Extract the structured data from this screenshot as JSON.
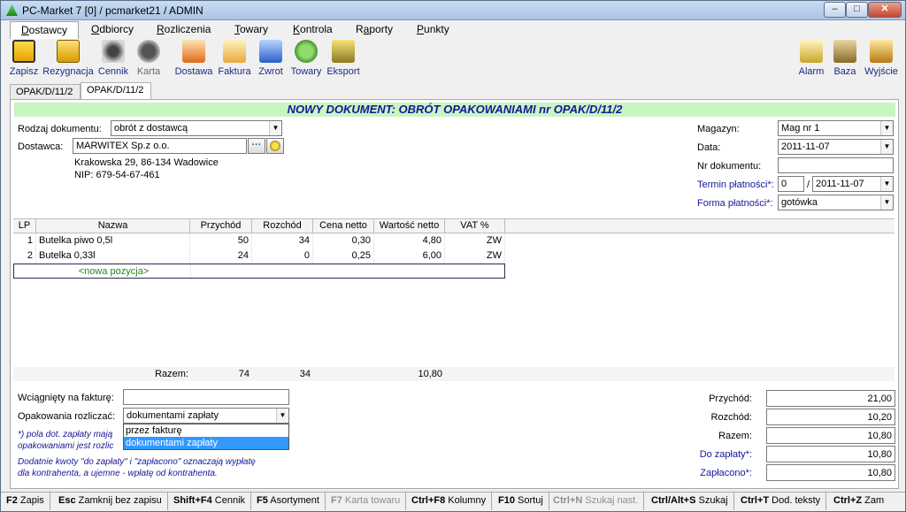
{
  "window": {
    "title": "PC-Market 7 [0] / pcmarket21 / ADMIN",
    "min": "–",
    "max": "□",
    "close": "✕"
  },
  "menu": [
    {
      "label": "Dostawcy",
      "u": "D",
      "rest": "ostawcy"
    },
    {
      "label": "Odbiorcy",
      "u": "O",
      "rest": "dbiorcy"
    },
    {
      "label": "Rozliczenia",
      "u": "R",
      "rest": "ozliczenia"
    },
    {
      "label": "Towary",
      "u": "T",
      "rest": "owary"
    },
    {
      "label": "Kontrola",
      "u": "K",
      "rest": "ontrola"
    },
    {
      "label": "Raporty",
      "pre": "R",
      "u": "a",
      "rest": "porty"
    },
    {
      "label": "Punkty",
      "u": "P",
      "rest": "unkty"
    }
  ],
  "toolbar": {
    "zapisz": "Zapisz",
    "rezygnacja": "Rezygnacja",
    "cennik": "Cennik",
    "karta": "Karta",
    "dostawa": "Dostawa",
    "faktura": "Faktura",
    "zwrot": "Zwrot",
    "towary": "Towary",
    "eksport": "Eksport",
    "alarm": "Alarm",
    "baza": "Baza",
    "wyjscie": "Wyjście"
  },
  "doc_tabs": [
    "OPAK/D/11/2",
    "OPAK/D/11/2"
  ],
  "doc": {
    "heading": "NOWY DOKUMENT: OBRÓT OPAKOWANIAMI nr OPAK/D/11/2",
    "rodzaj_label": "Rodzaj dokumentu:",
    "rodzaj_value": "obrót z dostawcą",
    "dostawca_label": "Dostawca:",
    "dostawca_value": "MARWITEX Sp.z o.o.",
    "dostawca_more": "···",
    "address": "Krakowska 29, 86-134 Wadowice",
    "nip": "NIP: 679-54-67-461",
    "magazyn_label": "Magazyn:",
    "magazyn_value": "Mag nr 1",
    "data_label": "Data:",
    "data_value": "2011-11-07",
    "nr_label": "Nr dokumentu:",
    "nr_value": "",
    "termin_label": "Termin płatności*:",
    "termin_days": "0",
    "termin_sep": "/",
    "termin_date": "2011-11-07",
    "forma_label": "Forma płatności*:",
    "forma_value": "gotówka"
  },
  "grid": {
    "headers": [
      "LP",
      "Nazwa",
      "Przychód",
      "Rozchód",
      "Cena netto",
      "Wartość netto",
      "VAT %"
    ],
    "rows": [
      {
        "lp": "1",
        "nazwa": "Butelka piwo 0,5l",
        "przychod": "50",
        "rozchod": "34",
        "cena": "0,30",
        "wartosc": "4,80",
        "vat": "ZW"
      },
      {
        "lp": "2",
        "nazwa": "Butelka 0,33l",
        "przychod": "24",
        "rozchod": "0",
        "cena": "0,25",
        "wartosc": "6,00",
        "vat": "ZW"
      }
    ],
    "new_row": "<nowa pozycja>",
    "totals": {
      "label": "Razem:",
      "przychod": "74",
      "rozchod": "34",
      "wartosc": "10,80"
    }
  },
  "bottom": {
    "faktura_label": "Wciągnięty na fakturę:",
    "faktura_value": "",
    "rozliczac_label": "Opakowania rozliczać:",
    "rozliczac_value": "dokumentami zapłaty",
    "options": [
      "przez fakturę",
      "dokumentami zapłaty"
    ],
    "note1a": "*) pola dot. zapłaty mają",
    "note1b": "opakowaniami jest rozlic",
    "note2a": "Dodatnie kwoty \"do zapłaty\" i \"zapłacono\" oznaczają wypłatę",
    "note2b": "dla kontrahenta, a ujemne - wpłatę od kontrahenta."
  },
  "summary": [
    {
      "label": "Przychód:",
      "value": "21,00",
      "blue": false
    },
    {
      "label": "Rozchód:",
      "value": "10,20",
      "blue": false
    },
    {
      "label": "Razem:",
      "value": "10,80",
      "blue": false
    },
    {
      "label": "Do zapłaty*:",
      "value": "10,80",
      "blue": true
    },
    {
      "label": "Zapłacono*:",
      "value": "10,80",
      "blue": true
    }
  ],
  "status": [
    {
      "key": "F2",
      "label": "Zapis"
    },
    {
      "key": "Esc",
      "label": "Zamknij bez zapisu"
    },
    {
      "key": "Shift+F4",
      "label": "Cennik"
    },
    {
      "key": "F5",
      "label": "Asortyment"
    },
    {
      "key": "F7",
      "label": "Karta towaru"
    },
    {
      "key": "Ctrl+F8",
      "label": "Kolumny"
    },
    {
      "key": "F10",
      "label": "Sortuj"
    },
    {
      "key": "Ctrl+N",
      "label": "Szukaj nast."
    },
    {
      "key": "Ctrl/Alt+S",
      "label": "Szukaj"
    },
    {
      "key": "Ctrl+T",
      "label": "Dod. teksty"
    },
    {
      "key": "Ctrl+Z",
      "label": "Zam"
    }
  ],
  "colors": {
    "accent": "#16169a",
    "heading_bg": "#c8f5c2",
    "selected": "#3399ff"
  }
}
